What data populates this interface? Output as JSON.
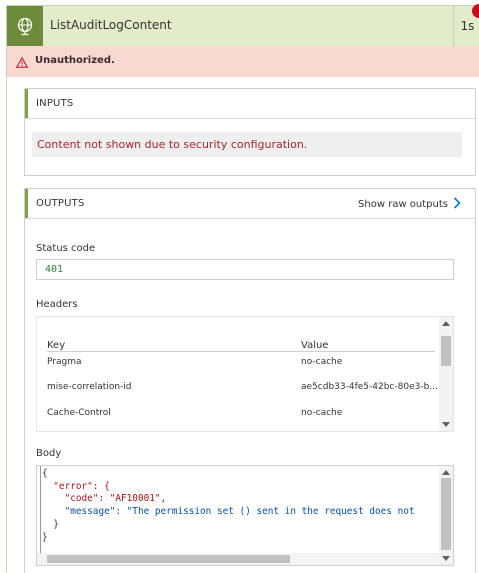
{
  "header": {
    "title": "ListAuditLogContent",
    "duration": "1s",
    "icon": "globe-icon",
    "icon_bg": "#6c8c3a",
    "bg": "#e2ecca"
  },
  "error": {
    "icon": "warning-icon",
    "text": "Unauthorized."
  },
  "inputs": {
    "title": "INPUTS",
    "message": "Content not shown due to security configuration."
  },
  "outputs": {
    "title": "OUTPUTS",
    "raw_link": "Show raw outputs",
    "status_label": "Status code",
    "status_value": "401",
    "headers_label": "Headers",
    "headers_columns": [
      "Key",
      "Value"
    ],
    "headers_rows": [
      {
        "key": "Pragma",
        "value": "no-cache"
      },
      {
        "key": "mise-correlation-id",
        "value": "ae5cdb33-4fe5-42bc-80e3-b..."
      },
      {
        "key": "Cache-Control",
        "value": "no-cache"
      }
    ],
    "body_label": "Body",
    "body_lines": [
      "{",
      "  \"error\": {",
      "    \"code\": \"AF10001\",",
      "    \"message\": \"The permission set () sent in the request does not",
      "  }",
      "}"
    ]
  },
  "colors": {
    "accent": "#7fa447",
    "error_bg": "#f8d9d2",
    "error_text": "#a4262c",
    "status_value": "#2f7e3c"
  }
}
